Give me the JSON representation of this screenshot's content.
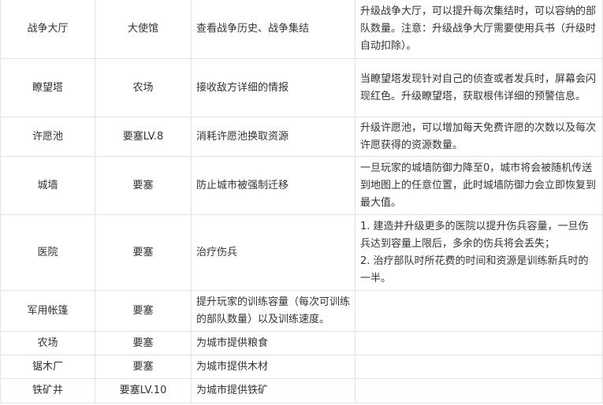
{
  "table": {
    "rows": [
      {
        "name": "战争大厅",
        "requirement": "大使馆",
        "function": "查看战争历史、战争集结",
        "notes": [
          "升级战争大厅，可以提升每次集结时，可以容纳的部队数量。注意：升级战争大厅需要使用兵书（升级时自动扣除）。"
        ]
      },
      {
        "name": "瞭望塔",
        "requirement": "农场",
        "function": "接收敌方详细的情报",
        "notes": [
          "当瞭望塔发现针对自己的侦查或者发兵时，屏幕会闪现红色。升级瞭望塔，获取根伟详细的预警信息。"
        ]
      },
      {
        "name": "许愿池",
        "requirement": "要塞LV.8",
        "function": "消耗许愿池换取资源",
        "notes": [
          "升级许愿池，可以增加每天免费许愿的次数以及每次许愿获得的资源数量。"
        ]
      },
      {
        "name": "城墙",
        "requirement": "要塞",
        "function": "防止城市被强制迁移",
        "notes": [
          "一旦玩家的城墙防御力降至0，城市将会被随机传送到地图上的任意位置，此时城墙防御力会立即恢复到最大值。"
        ]
      },
      {
        "name": "医院",
        "requirement": "要塞",
        "function": "治疗伤兵",
        "notes": [
          "1. 建造并升级更多的医院以提升伤兵容量，一旦伤兵达到容量上限后，多余的伤兵将会丢失；",
          "2. 治疗部队时所花费的时间和资源是训练新兵时的一半。"
        ]
      },
      {
        "name": "军用帐篷",
        "requirement": "要塞",
        "function": "提升玩家的训练容量（每次可训练的部队数量）以及训练速度。",
        "notes": []
      },
      {
        "name": "农场",
        "requirement": "要塞",
        "function": "为城市提供粮食",
        "notes": []
      },
      {
        "name": "锯木厂",
        "requirement": "要塞",
        "function": "为城市提供木材",
        "notes": []
      },
      {
        "name": "铁矿井",
        "requirement": "要塞LV.10",
        "function": "为城市提供铁矿",
        "notes": []
      }
    ]
  }
}
